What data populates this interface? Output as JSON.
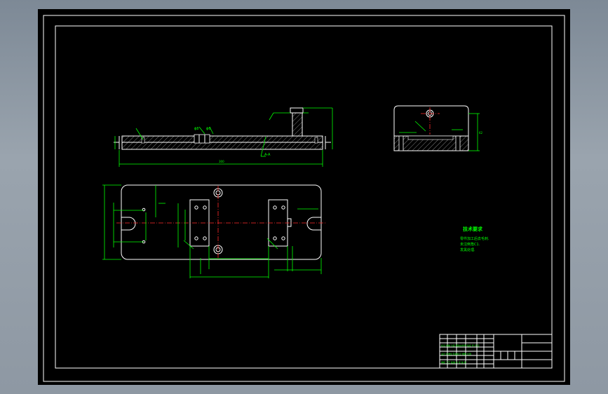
{
  "colors": {
    "background": "#000000",
    "outline": "#ffffff",
    "dimension": "#00ff00",
    "centerline": "#ff2a2a",
    "chrome": "#8e98a3"
  },
  "tech_requirements": {
    "title": "技术要求",
    "lines": [
      "零件加工后去毛刺.",
      "未注倒角C1.",
      "发黑处理."
    ]
  },
  "dims": {
    "overall_length": "300",
    "section": "A-A",
    "height": "62"
  },
  "title_block": {
    "row1": "标记 处数 分区 更改文件号 签名 年.月.日",
    "row2": "设计 标准化 阶段标记 重量 比例",
    "row3": "审核 工艺 批准 共 张 第 张"
  }
}
